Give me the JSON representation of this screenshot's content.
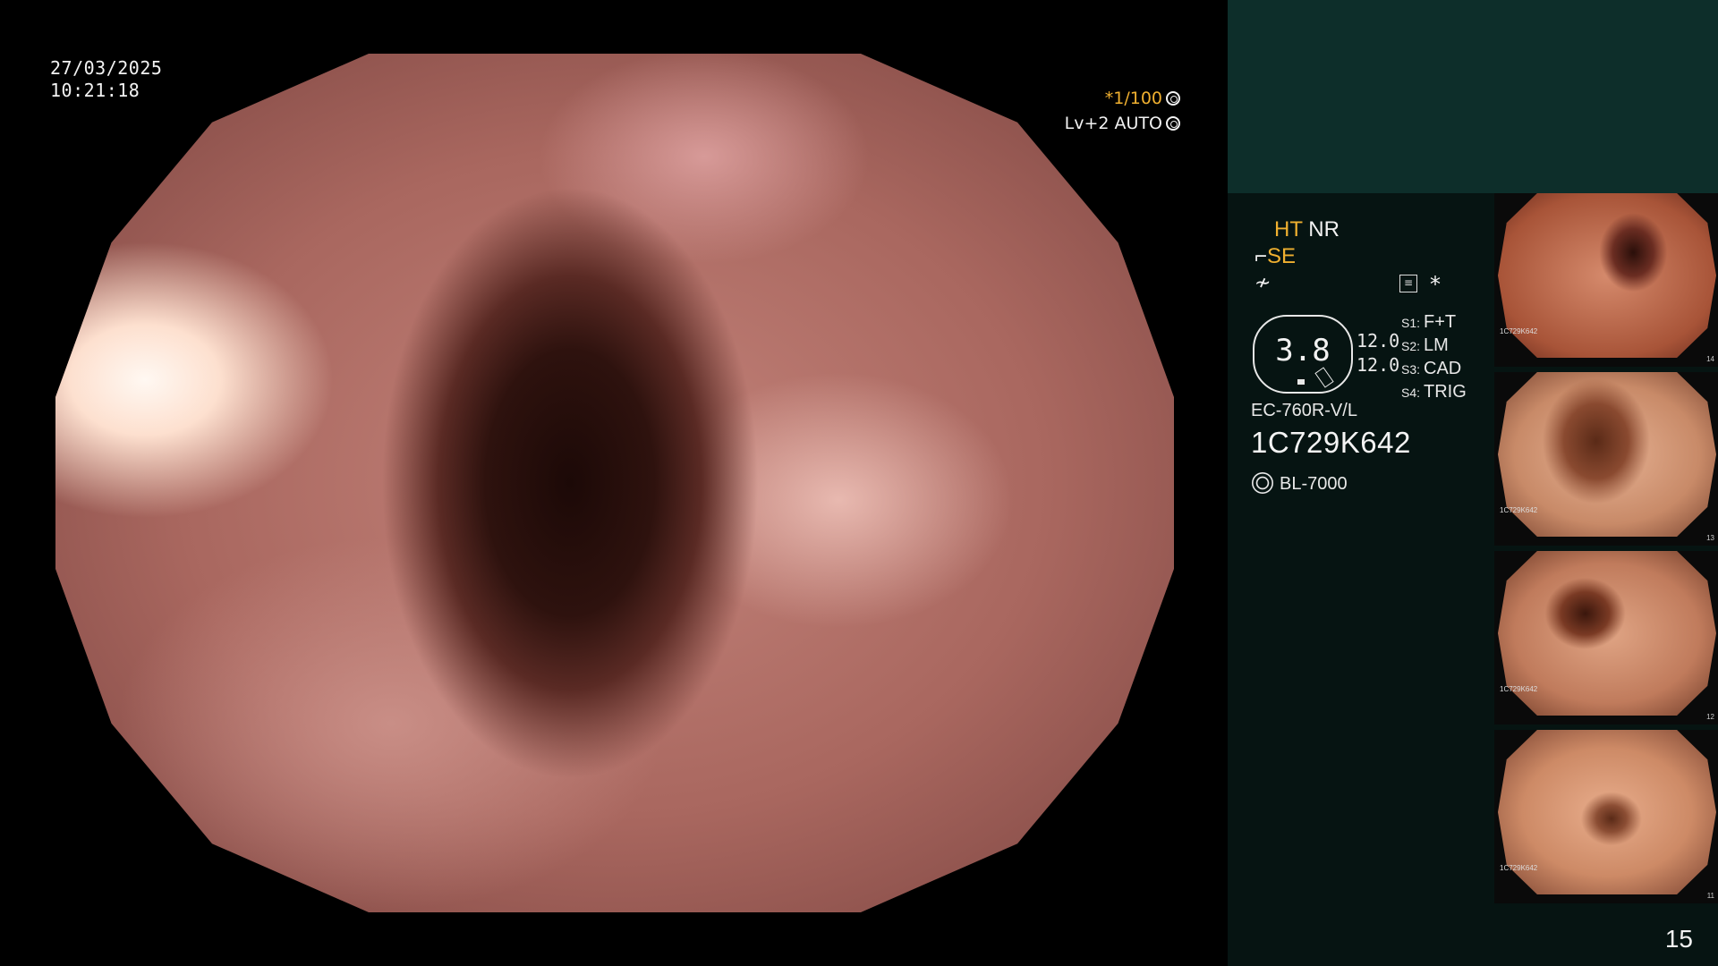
{
  "overlay": {
    "date": "27/03/2025",
    "time": "10:21:18",
    "shutter": "*1/100",
    "level": "Lv+2 AUTO"
  },
  "panel": {
    "ht": "HT",
    "nr": "NR",
    "se": "SE",
    "gauge_value": "3.8",
    "vals": [
      "12.0",
      "12.0"
    ],
    "switches": [
      {
        "key": "S1:",
        "value": "F+T"
      },
      {
        "key": "S2:",
        "value": "LM"
      },
      {
        "key": "S3:",
        "value": "CAD"
      },
      {
        "key": "S4:",
        "value": "TRIG"
      }
    ],
    "model": "EC-760R-V/L",
    "serial": "1C729K642",
    "lamp": "BL-7000",
    "page_number": "15"
  },
  "thumbnails": [
    {
      "serial": "1C729K642",
      "num": "14"
    },
    {
      "serial": "1C729K642",
      "num": "13"
    },
    {
      "serial": "1C729K642",
      "num": "12"
    },
    {
      "serial": "1C729K642",
      "num": "11"
    }
  ],
  "colors": {
    "accent_orange": "#f0b030",
    "panel_bg": "#061412",
    "panel_top": "#0d2e2a"
  }
}
